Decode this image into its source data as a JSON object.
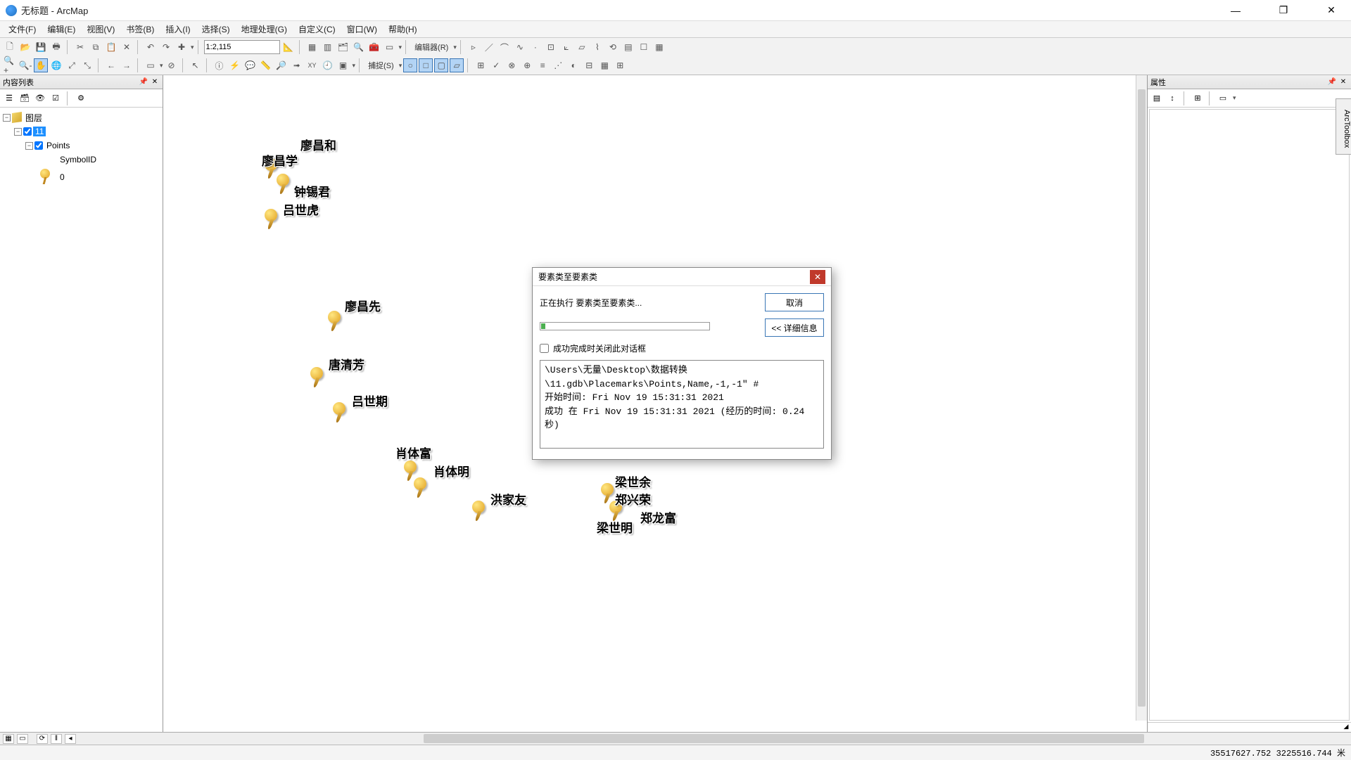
{
  "window": {
    "title": "无标题 - ArcMap",
    "minimize": "—",
    "maximize": "❐",
    "close": "✕"
  },
  "menu": {
    "file": "文件(F)",
    "edit": "编辑(E)",
    "view": "视图(V)",
    "bookmarks": "书签(B)",
    "insert": "插入(I)",
    "selection": "选择(S)",
    "geoprocessing": "地理处理(G)",
    "customize": "自定义(C)",
    "windows": "窗口(W)",
    "help": "帮助(H)"
  },
  "toolbar": {
    "scale": "1:2,115",
    "editor_label": "编辑器(R)",
    "snapping_label": "捕捉(S)"
  },
  "toc": {
    "header": "内容列表",
    "root": "图层",
    "layer_11": "11",
    "points": "Points",
    "symbol_field": "SymbolID",
    "symbol_value": "0"
  },
  "attrs": {
    "header": "属性",
    "side_tab": "ArcToolbox"
  },
  "map": {
    "labels": {
      "l1": "廖昌和",
      "l2": "廖昌学",
      "l3": "钟锡君",
      "l4": "吕世虎",
      "l5": "廖昌先",
      "l6": "唐清芳",
      "l7": "吕世期",
      "l8": "肖体富",
      "l9": "肖体明",
      "l10": "洪家友",
      "l11": "梁世余",
      "l12": "郑兴荣",
      "l13": "郑龙富",
      "l14": "梁世明"
    }
  },
  "dialog": {
    "title": "要素类至要素类",
    "status": "正在执行 要素类至要素类...",
    "cancel": "取消",
    "details": "<< 详细信息",
    "close_on_success": "成功完成时关闭此对话框",
    "log": "\\Users\\无量\\Desktop\\数据转换\\11.gdb\\Placemarks\\Points,Name,-1,-1\" #\n开始时间: Fri Nov 19 15:31:31 2021\n成功 在 Fri Nov 19 15:31:31 2021 (经历的时间: 0.24 秒)"
  },
  "statusbar": {
    "coords": "35517627.752  3225516.744 米"
  },
  "viewtabs": {
    "data": "▦",
    "layout": "▭",
    "refresh": "⟳",
    "pause": "‖",
    "left": "◂"
  }
}
